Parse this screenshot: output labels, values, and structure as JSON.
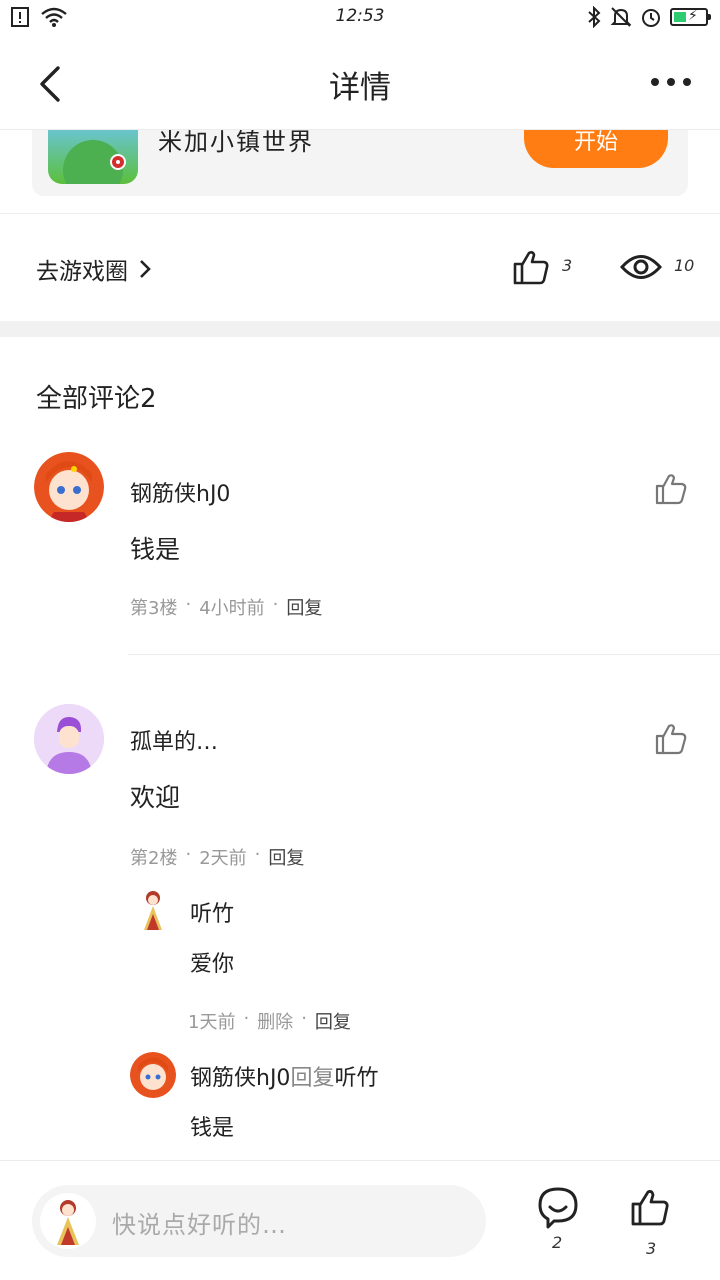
{
  "status_bar": {
    "time": "12:53"
  },
  "header": {
    "title": "详情"
  },
  "game_card": {
    "name": "米加小镇世界",
    "start_label": "开始"
  },
  "meta": {
    "goto_label": "去游戏圈",
    "like_count": "3",
    "view_count": "10"
  },
  "comments": {
    "title": "全部评论2",
    "items": [
      {
        "user": "钢筋侠hJ0",
        "text": "钱是",
        "floor": "第3楼",
        "time": "4小时前",
        "reply": "回复"
      },
      {
        "user": "孤单的…",
        "text": "欢迎",
        "floor": "第2楼",
        "time": "2天前",
        "reply": "回复",
        "replies": [
          {
            "user": "听竹",
            "text": "爱你",
            "time": "1天前",
            "delete": "删除",
            "reply": "回复"
          },
          {
            "user": "钢筋侠hJ0",
            "reply_word": "回复",
            "target": "听竹",
            "text": "钱是"
          }
        ]
      }
    ]
  },
  "bottom_bar": {
    "placeholder": "快说点好听的…",
    "comment_count": "2",
    "like_count": "3"
  },
  "colors": {
    "accent": "#ff7d12",
    "battery": "#2ecc71"
  }
}
